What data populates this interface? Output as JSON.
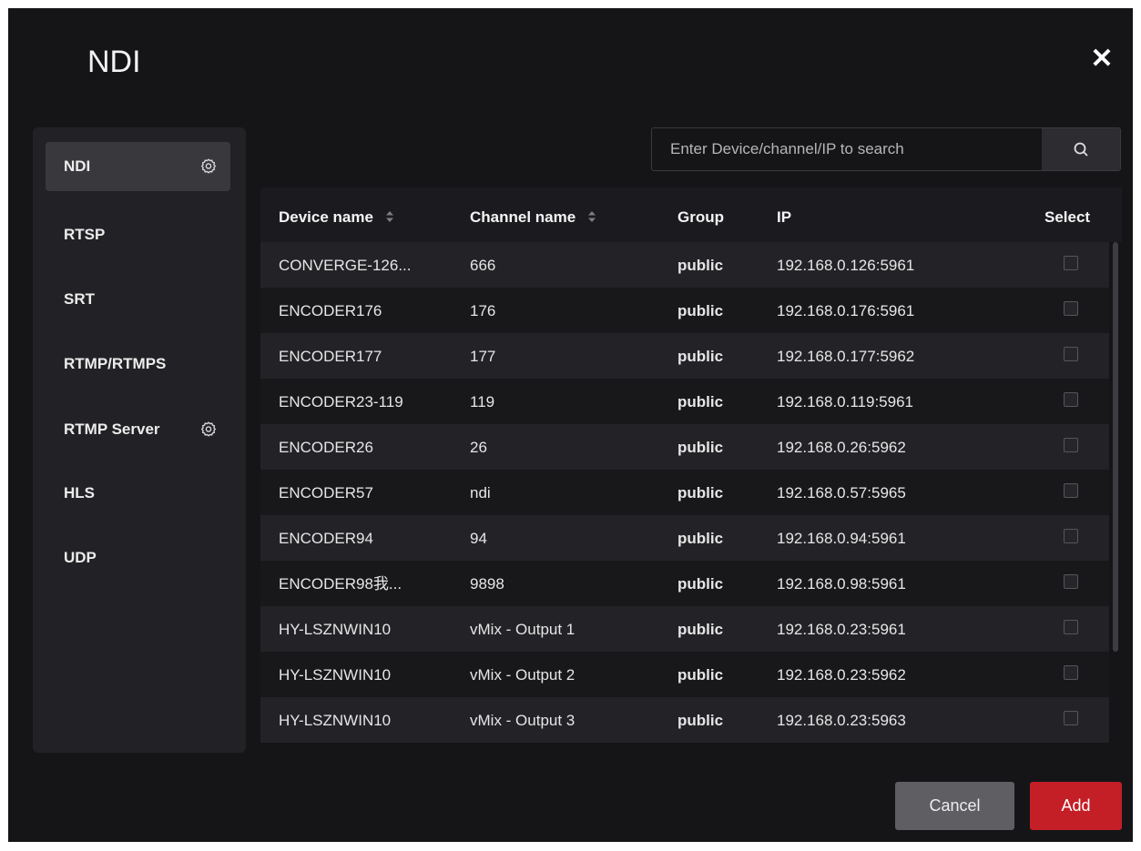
{
  "dialog": {
    "title": "NDI",
    "close_icon": "close-icon (×)"
  },
  "sidebar": {
    "items": [
      {
        "label": "NDI",
        "active": true,
        "gear": true
      },
      {
        "label": "RTSP",
        "active": false,
        "gear": false
      },
      {
        "label": "SRT",
        "active": false,
        "gear": false
      },
      {
        "label": "RTMP/RTMPS",
        "active": false,
        "gear": false
      },
      {
        "label": "RTMP Server",
        "active": false,
        "gear": true
      },
      {
        "label": "HLS",
        "active": false,
        "gear": false
      },
      {
        "label": "UDP",
        "active": false,
        "gear": false
      }
    ]
  },
  "search": {
    "placeholder": "Enter Device/channel/IP to search",
    "icon": "search-icon"
  },
  "table": {
    "headers": {
      "device": "Device name",
      "channel": "Channel name",
      "group": "Group",
      "ip": "IP",
      "select": "Select"
    },
    "rows": [
      {
        "device": "CONVERGE-126...",
        "channel": "666",
        "group": "public",
        "ip": "192.168.0.126:5961"
      },
      {
        "device": "ENCODER176",
        "channel": "176",
        "group": "public",
        "ip": "192.168.0.176:5961"
      },
      {
        "device": "ENCODER177",
        "channel": "177",
        "group": "public",
        "ip": "192.168.0.177:5962"
      },
      {
        "device": "ENCODER23-119",
        "channel": "119",
        "group": "public",
        "ip": "192.168.0.119:5961"
      },
      {
        "device": "ENCODER26",
        "channel": "26",
        "group": "public",
        "ip": "192.168.0.26:5962"
      },
      {
        "device": "ENCODER57",
        "channel": "ndi",
        "group": "public",
        "ip": "192.168.0.57:5965"
      },
      {
        "device": "ENCODER94",
        "channel": "94",
        "group": "public",
        "ip": "192.168.0.94:5961"
      },
      {
        "device": "ENCODER98我...",
        "channel": "9898",
        "group": "public",
        "ip": "192.168.0.98:5961"
      },
      {
        "device": "HY-LSZNWIN10",
        "channel": "vMix - Output 1",
        "group": "public",
        "ip": "192.168.0.23:5961"
      },
      {
        "device": "HY-LSZNWIN10",
        "channel": "vMix - Output 2",
        "group": "public",
        "ip": "192.168.0.23:5962"
      },
      {
        "device": "HY-LSZNWIN10",
        "channel": "vMix - Output 3",
        "group": "public",
        "ip": "192.168.0.23:5963"
      }
    ]
  },
  "buttons": {
    "cancel": "Cancel",
    "add": "Add"
  },
  "colors": {
    "background": "#151518",
    "accent": "#c41e26",
    "panel": "#222226"
  }
}
